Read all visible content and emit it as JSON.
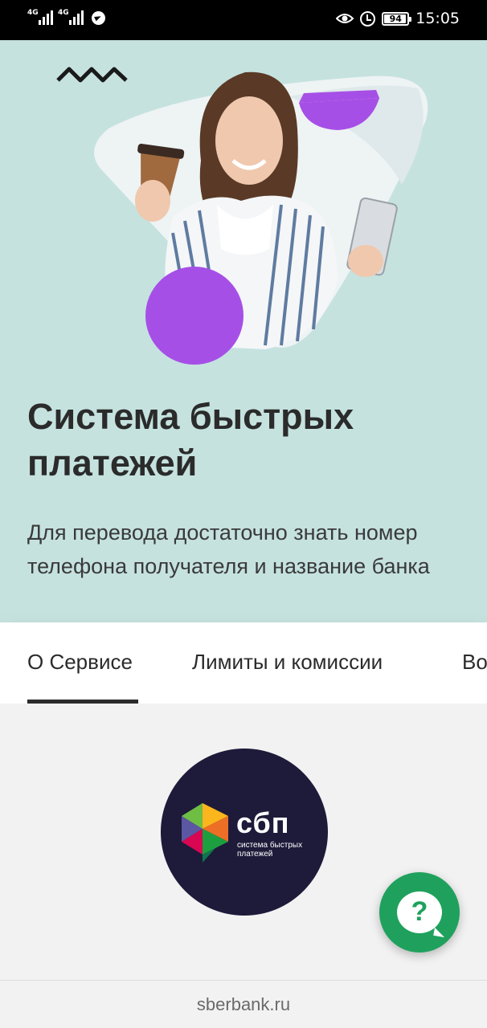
{
  "status_bar": {
    "network_1": "4G",
    "network_2": "4G",
    "battery": "94",
    "time": "15:05",
    "icons": [
      "signal-icon",
      "signal-icon",
      "telegram-icon",
      "eye-icon",
      "alarm-icon",
      "battery-icon"
    ]
  },
  "hero": {
    "title": "Система быстрых платежей",
    "subtitle": "Для перевода достаточно знать номер телефона получателя и название банка",
    "colors": {
      "background": "#c5e2df",
      "accent_purple": "#a64fe6"
    }
  },
  "tabs": [
    {
      "label": "О Сервисе",
      "active": true
    },
    {
      "label": "Лимиты и комиссии",
      "active": false
    },
    {
      "label": "Во",
      "active": false
    }
  ],
  "sbp_logo": {
    "name": "сбп",
    "subtitle": "система быстрых платежей",
    "background": "#1e1a3a"
  },
  "help_button": {
    "label": "?",
    "color": "#1fa15d"
  },
  "url_bar": {
    "url": "sberbank.ru"
  }
}
